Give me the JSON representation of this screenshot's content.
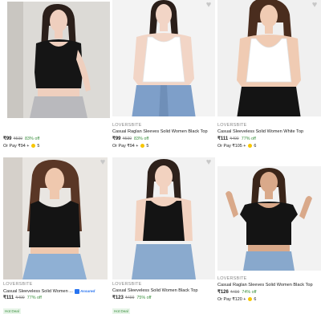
{
  "icons": {
    "wishlist": "heart-icon",
    "coin": "supercoin-icon",
    "assured": "assured-badge-icon"
  },
  "colors": {
    "price": "#212121",
    "discount": "#388e3c",
    "mrp": "#878787",
    "coin": "#f7c600",
    "assured": "#2874f0"
  },
  "products": [
    {
      "brand": "",
      "title": "",
      "price": "₹99",
      "mrp": "₹599",
      "off": "83% off",
      "pay_prefix": "Or Pay",
      "pay_amount": "₹94",
      "pay_plus": "+",
      "coins": "5",
      "assured": "",
      "deal": ""
    },
    {
      "brand": "LOVERSBITE",
      "title": "Casual Raglan Sleeves Solid Women Black Top",
      "price": "₹99",
      "mrp": "₹599",
      "off": "83% off",
      "pay_prefix": "Or Pay",
      "pay_amount": "₹94",
      "pay_plus": "+",
      "coins": "5",
      "assured": "",
      "deal": ""
    },
    {
      "brand": "LOVERSBITE",
      "title": "Casual Sleeveless Solid Women White Top",
      "price": "₹111",
      "mrp": "₹499",
      "off": "77% off",
      "pay_prefix": "Or Pay",
      "pay_amount": "₹105",
      "pay_plus": "+",
      "coins": "6",
      "assured": "",
      "deal": ""
    },
    {
      "brand": "LOVERSBITE",
      "title": "Casual Sleeveless Solid Women White Top",
      "price": "₹111",
      "mrp": "₹499",
      "off": "77% off",
      "pay_prefix": "Or Pay",
      "pay_amount": "₹105",
      "pay_plus": "+",
      "coins": "6",
      "assured": "",
      "deal": ""
    },
    {
      "brand": "LOVERSBITE",
      "title": "Casual Sleeveless Solid Women ...",
      "price": "₹111",
      "mrp": "₹499",
      "off": "77% off",
      "pay_prefix": "",
      "pay_amount": "",
      "pay_plus": "",
      "coins": "",
      "assured": "Assured",
      "deal": "Hot Deal"
    },
    {
      "brand": "LOVERSBITE",
      "title": "Casual Sleeveless Solid Women Black Top",
      "price": "₹123",
      "mrp": "₹499",
      "off": "75% off",
      "pay_prefix": "",
      "pay_amount": "",
      "pay_plus": "",
      "coins": "",
      "assured": "",
      "deal": "Hot Deal"
    },
    {
      "brand": "LOVERSBITE",
      "title": "Casual Raglan Sleeves Solid Women Black Top",
      "price": "₹126",
      "mrp": "₹499",
      "off": "74% off",
      "pay_prefix": "Or Pay",
      "pay_amount": "₹120",
      "pay_plus": "+",
      "coins": "6",
      "assured": "",
      "deal": ""
    }
  ]
}
